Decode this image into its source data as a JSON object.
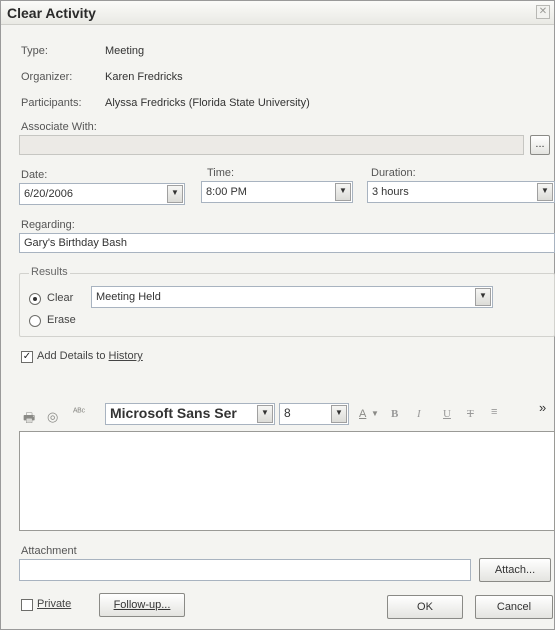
{
  "window": {
    "title": "Clear Activity",
    "close_glyph": "✕"
  },
  "info": {
    "type_label": "Type:",
    "type_value": "Meeting",
    "organizer_label": "Organizer:",
    "organizer_value": "Karen Fredricks",
    "participants_label": "Participants:",
    "participants_value": "Alyssa Fredricks (Florida State University)",
    "associate_label": "Associate With:",
    "associate_value": "",
    "browse_label": "..."
  },
  "date": {
    "label": "Date:",
    "value": "6/20/2006"
  },
  "time": {
    "label": "Time:",
    "value": "8:00 PM"
  },
  "duration": {
    "label": "Duration:",
    "value": "3 hours"
  },
  "regarding": {
    "label": "Regarding:",
    "value": "Gary's Birthday Bash"
  },
  "results": {
    "group_label": "Results",
    "clear_label": "Clear",
    "erase_label": "Erase",
    "selected": "clear",
    "result_value": "Meeting Held"
  },
  "history": {
    "label_prefix": "Add Details to ",
    "label_accel": "History",
    "checked": true
  },
  "editor_toolbar": {
    "font_name": "Microsoft Sans Ser",
    "font_size": "8",
    "overflow_glyph": "»"
  },
  "attachment": {
    "label": "Attachment",
    "value": "",
    "attach_label": "Attach..."
  },
  "footer": {
    "private_label": "Private",
    "private_checked": false,
    "followup_label": "Follow-up...",
    "ok_label": "OK",
    "cancel_label": "Cancel"
  },
  "colors": {
    "window_bg": "#f4f4f1",
    "field_border": "#a8b3c0",
    "dropdown_arrow": "#3a5f9a"
  }
}
